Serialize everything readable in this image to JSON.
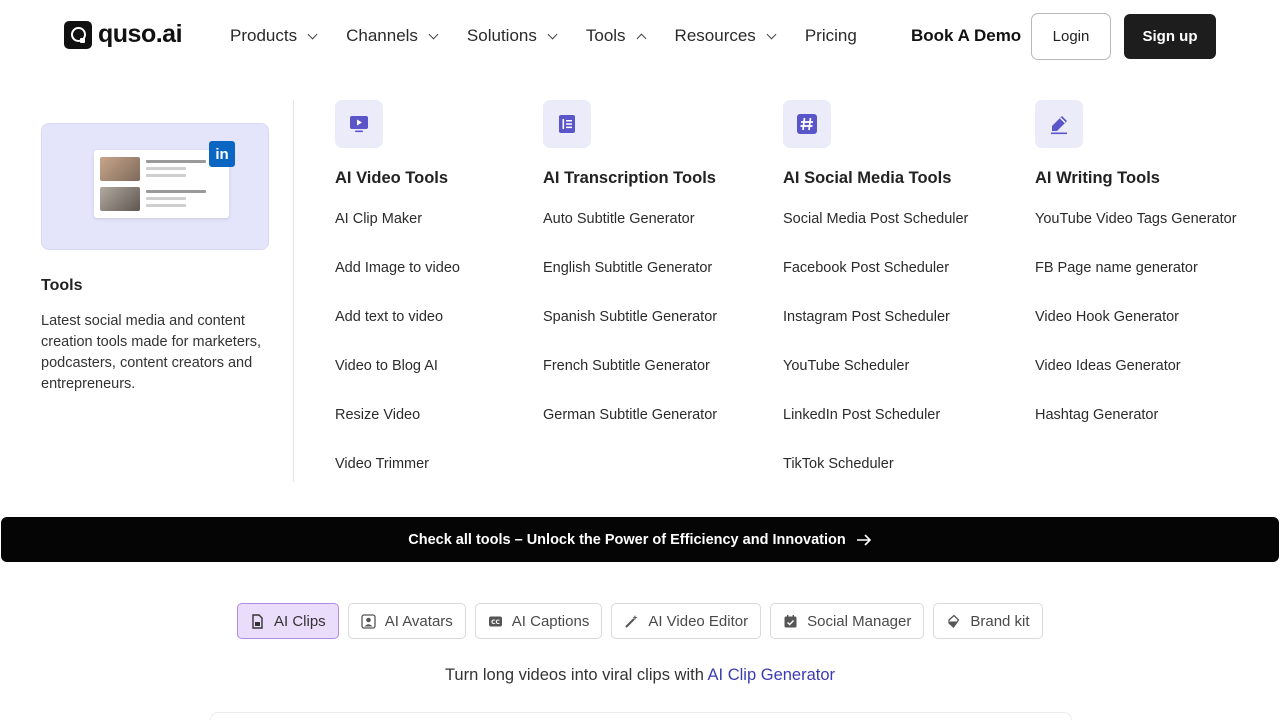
{
  "header": {
    "logo_text": "quso.ai",
    "nav": [
      {
        "label": "Products",
        "chevron": "down"
      },
      {
        "label": "Channels",
        "chevron": "down"
      },
      {
        "label": "Solutions",
        "chevron": "down"
      },
      {
        "label": "Tools",
        "chevron": "up"
      },
      {
        "label": "Resources",
        "chevron": "down"
      },
      {
        "label": "Pricing",
        "chevron": "none"
      }
    ],
    "book_demo": "Book A Demo",
    "login": "Login",
    "signup": "Sign up"
  },
  "menu": {
    "promo": {
      "badge": "in",
      "title": "Tools",
      "description": "Latest social media and content creation tools made for marketers, podcasters, content creators and entrepreneurs."
    },
    "columns": [
      {
        "title": "AI Video Tools",
        "icon": "video-play-icon",
        "links": [
          "AI Clip Maker",
          "Add Image to video",
          "Add text to video",
          "Video to Blog AI",
          "Resize Video",
          "Video Trimmer"
        ]
      },
      {
        "title": "AI Transcription Tools",
        "icon": "document-icon",
        "links": [
          "Auto Subtitle Generator",
          "English Subtitle Generator",
          "Spanish Subtitle Generator",
          "French Subtitle Generator",
          "German Subtitle Generator"
        ]
      },
      {
        "title": "AI Social Media Tools",
        "icon": "hashtag-icon",
        "links": [
          "Social Media Post Scheduler",
          "Facebook Post Scheduler",
          "Instagram Post Scheduler",
          "YouTube Scheduler",
          "LinkedIn Post Scheduler",
          "TikTok Scheduler"
        ]
      },
      {
        "title": "AI Writing Tools",
        "icon": "pencil-icon",
        "links": [
          "YouTube Video Tags Generator",
          "FB Page name generator",
          "Video Hook Generator",
          "Video Ideas Generator",
          "Hashtag Generator"
        ]
      }
    ]
  },
  "cta": {
    "text": "Check all tools – Unlock the Power of Efficiency and Innovation"
  },
  "tabs": [
    {
      "label": "AI Clips",
      "icon": "clip-file-icon",
      "active": true
    },
    {
      "label": "AI Avatars",
      "icon": "avatar-icon",
      "active": false
    },
    {
      "label": "AI Captions",
      "icon": "cc-icon",
      "active": false
    },
    {
      "label": "AI Video Editor",
      "icon": "magic-wand-icon",
      "active": false
    },
    {
      "label": "Social Manager",
      "icon": "calendar-check-icon",
      "active": false
    },
    {
      "label": "Brand kit",
      "icon": "paint-bucket-icon",
      "active": false
    }
  ],
  "tagline": {
    "prefix": "Turn long videos into viral clips with ",
    "highlight": "AI Clip Generator"
  },
  "colors": {
    "accent_purple": "#5a55c8",
    "tab_active_bg": "#eadcfb",
    "cta_bg": "#050505",
    "linkedin": "#0a66c2"
  }
}
